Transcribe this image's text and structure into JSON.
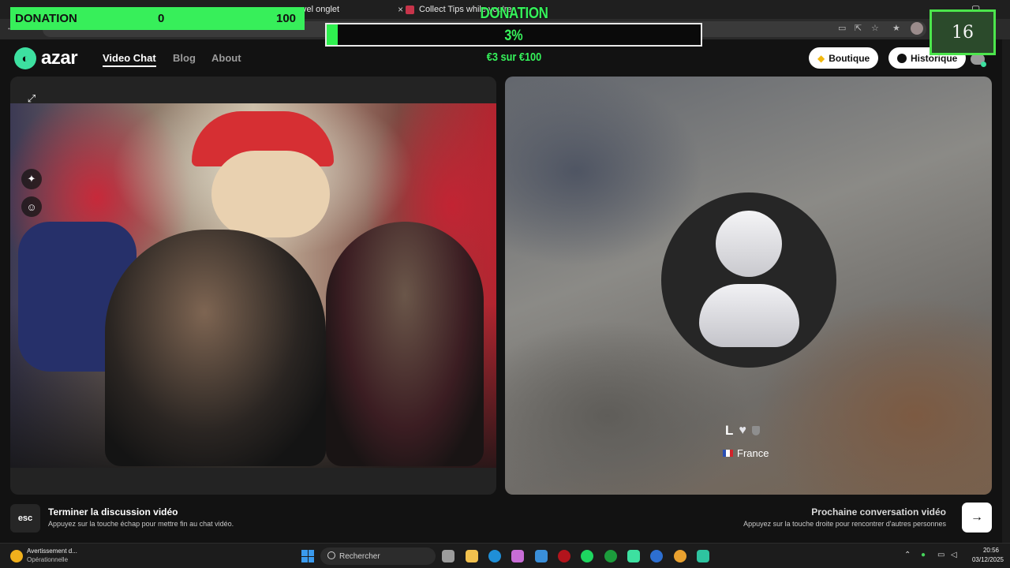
{
  "browser": {
    "tabs": [
      {
        "label": "vel onglet"
      },
      {
        "label": "Collect Tips while you're"
      }
    ],
    "close_glyph": "×"
  },
  "app": {
    "logo_text": "azar",
    "nav": [
      {
        "label": "Video Chat",
        "active": true
      },
      {
        "label": "Blog",
        "active": false
      },
      {
        "label": "About",
        "active": false
      }
    ],
    "boutique_label": "Boutique",
    "historique_label": "Historique"
  },
  "partner": {
    "name": "L",
    "heart_glyph": "♥",
    "country": "France"
  },
  "bottom": {
    "esc_key": "esc",
    "end_title": "Terminer la discussion vidéo",
    "end_sub": "Appuyez sur la touche échap pour mettre fin au chat vidéo.",
    "next_title": "Prochaine conversation vidéo",
    "next_sub": "Appuyez sur la touche droite pour rencontrer d'autres personnes",
    "next_glyph": "→"
  },
  "overlay": {
    "donation_label": "DONATION",
    "donation_current": "0",
    "donation_target": "100",
    "goal_title": "DONATION",
    "goal_percent": "3%",
    "goal_fraction": 0.03,
    "goal_amount": "€3 sur €100",
    "counter": "16"
  },
  "taskbar": {
    "notif_title": "Avertissement d...",
    "notif_sub": "Opérationnelle",
    "search_label": "Rechercher",
    "time": "20:56",
    "date": "03/12/2025"
  },
  "colors": {
    "accent_green": "#37ef5a",
    "azar_mint": "#3de0a0"
  }
}
